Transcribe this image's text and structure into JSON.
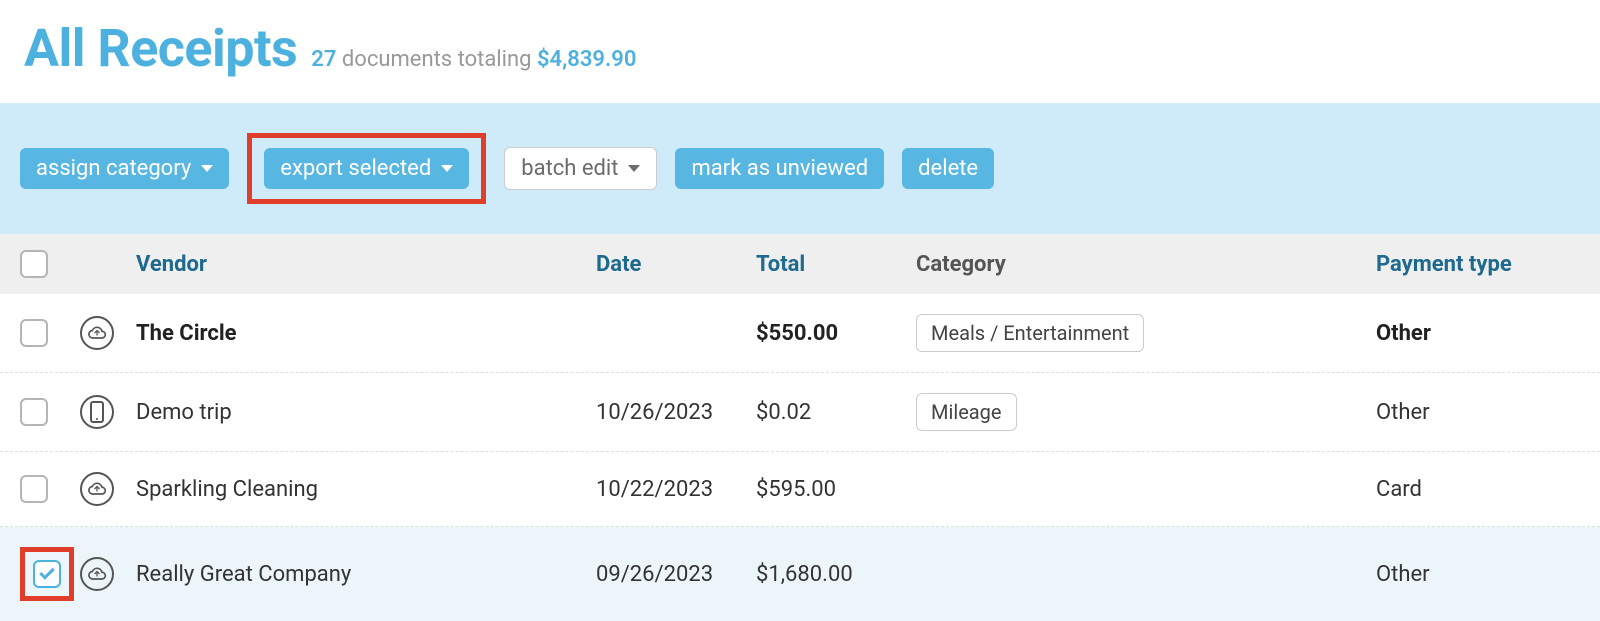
{
  "header": {
    "title": "All Receipts",
    "count": "27",
    "count_suffix": "documents totaling",
    "amount": "$4,839.90"
  },
  "toolbar": {
    "assign_category": "assign category",
    "export_selected": "export selected",
    "batch_edit": "batch edit",
    "mark_unviewed": "mark as unviewed",
    "delete": "delete"
  },
  "columns": {
    "vendor": "Vendor",
    "date": "Date",
    "total": "Total",
    "category": "Category",
    "payment_type": "Payment type"
  },
  "rows": [
    {
      "vendor": "The Circle",
      "date": "",
      "total": "$550.00",
      "category": "Meals / Entertainment",
      "payment": "Other",
      "icon": "cloud",
      "bold": true,
      "checked": false
    },
    {
      "vendor": "Demo trip",
      "date": "10/26/2023",
      "total": "$0.02",
      "category": "Mileage",
      "payment": "Other",
      "icon": "phone",
      "bold": false,
      "checked": false
    },
    {
      "vendor": "Sparkling Cleaning",
      "date": "10/22/2023",
      "total": "$595.00",
      "category": "",
      "payment": "Card",
      "icon": "cloud",
      "bold": false,
      "checked": false
    },
    {
      "vendor": "Really Great Company",
      "date": "09/26/2023",
      "total": "$1,680.00",
      "category": "",
      "payment": "Other",
      "icon": "cloud",
      "bold": false,
      "checked": true
    }
  ]
}
